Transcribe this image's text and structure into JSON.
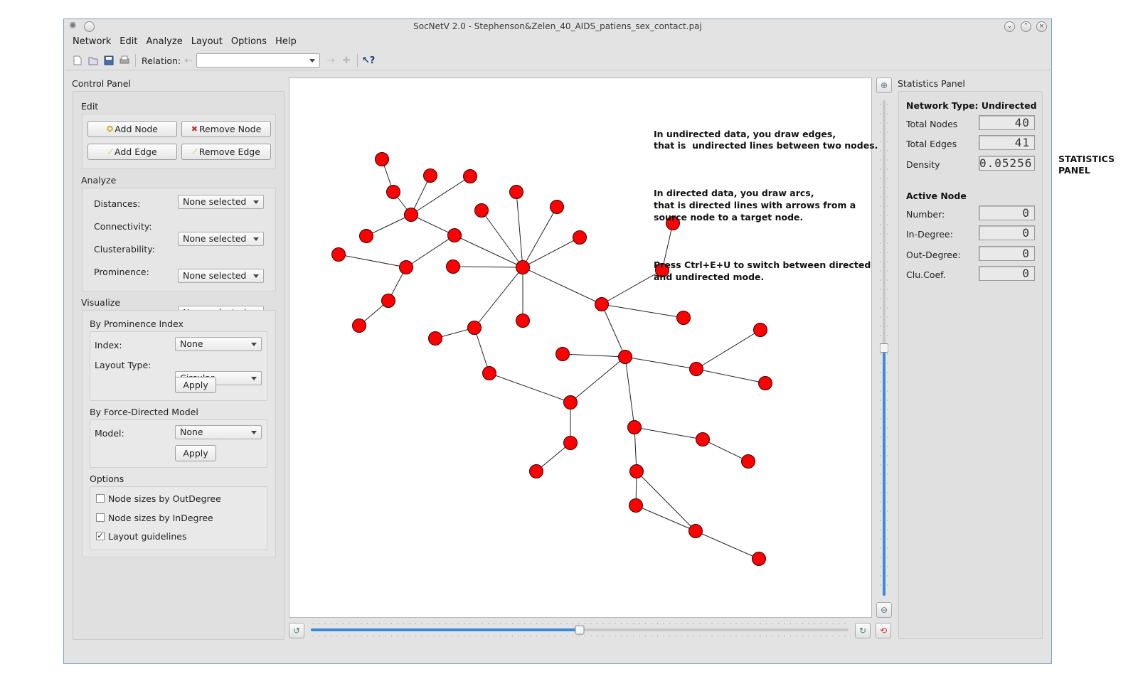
{
  "window": {
    "title": "SocNetV 2.0 - Stephenson&Zelen_40_AIDS_patiens_sex_contact.paj"
  },
  "menu": [
    "Network",
    "Edit",
    "Analyze",
    "Layout",
    "Options",
    "Help"
  ],
  "toolbar": {
    "relation_label": "Relation:",
    "relation_value": ""
  },
  "control_panel": {
    "title": "Control Panel",
    "edit": {
      "title": "Edit",
      "add_node": "Add Node",
      "remove_node": "Remove Node",
      "add_edge": "Add Edge",
      "remove_edge": "Remove Edge"
    },
    "analyze": {
      "title": "Analyze",
      "rows": [
        {
          "label": "Distances:",
          "value": "None selected"
        },
        {
          "label": "Connectivity:",
          "value": "None selected"
        },
        {
          "label": "Clusterability:",
          "value": "None selected"
        },
        {
          "label": "Prominence:",
          "value": "None selected"
        }
      ]
    },
    "visualize": {
      "title": "Visualize",
      "prominence": {
        "title": "By Prominence Index",
        "index_label": "Index:",
        "index_value": "None",
        "layout_label": "Layout Type:",
        "layout_value": "Circular",
        "apply": "Apply"
      },
      "force": {
        "title": "By Force-Directed Model",
        "model_label": "Model:",
        "model_value": "None",
        "apply": "Apply"
      }
    },
    "options": {
      "title": "Options",
      "items": [
        {
          "label": "Node sizes by OutDegree",
          "checked": false
        },
        {
          "label": "Node sizes by InDegree",
          "checked": false
        },
        {
          "label": "Layout guidelines",
          "checked": true
        }
      ]
    }
  },
  "canvas": {
    "info_lines": [
      "In undirected data, you draw edges,\nthat is  undirected lines between two nodes.",
      "In directed data, you draw arcs,\nthat is directed lines with arrows from a\nsource node to a target node.",
      "Press Ctrl+E+U to switch between directed\nand undirected mode."
    ],
    "node_color": "#ff0000",
    "node_count": 40
  },
  "statistics_panel": {
    "title": "Statistics Panel",
    "network_type": "Network Type: Undirected",
    "total_nodes_label": "Total Nodes",
    "total_nodes": "40",
    "total_edges_label": "Total Edges",
    "total_edges": "41",
    "density_label": "Density",
    "density": "0.05256",
    "active_node_title": "Active Node",
    "number_label": "Number:",
    "number": "0",
    "in_degree_label": "In-Degree:",
    "in_degree": "0",
    "out_degree_label": "Out-Degree:",
    "out_degree": "0",
    "clu_coef_label": "Clu.Coef.",
    "clu_coef": "0"
  },
  "side_label": "STATISTICS\nPANEL",
  "zoom_slider_level": 0.5,
  "rotate_slider_level": 0.5
}
